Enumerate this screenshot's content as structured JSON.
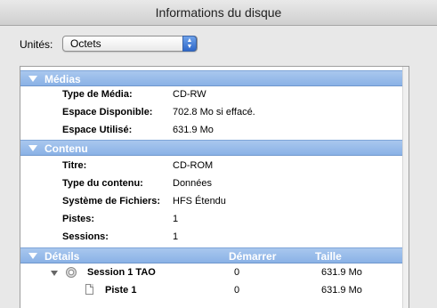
{
  "window": {
    "title": "Informations du disque"
  },
  "units": {
    "label": "Unités:",
    "selected": "Octets"
  },
  "sections": {
    "medias": {
      "title": "Médias",
      "rows": [
        {
          "label": "Type de Média:",
          "value": "CD-RW"
        },
        {
          "label": "Espace Disponible:",
          "value": "702.8 Mo si effacé."
        },
        {
          "label": "Espace Utilisé:",
          "value": "631.9 Mo"
        }
      ]
    },
    "contenu": {
      "title": "Contenu",
      "rows": [
        {
          "label": "Titre:",
          "value": "CD-ROM"
        },
        {
          "label": "Type du contenu:",
          "value": "Données"
        },
        {
          "label": "Système de Fichiers:",
          "value": "HFS Étendu"
        },
        {
          "label": "Pistes:",
          "value": "1"
        },
        {
          "label": "Sessions:",
          "value": "1"
        }
      ]
    },
    "details": {
      "title": "Détails",
      "col_start": "Démarrer",
      "col_size": "Taille",
      "items": [
        {
          "name": "Session 1 TAO",
          "start": "0",
          "size": "631.9 Mo"
        },
        {
          "name": "Piste 1",
          "start": "0",
          "size": "631.9 Mo"
        }
      ]
    }
  }
}
